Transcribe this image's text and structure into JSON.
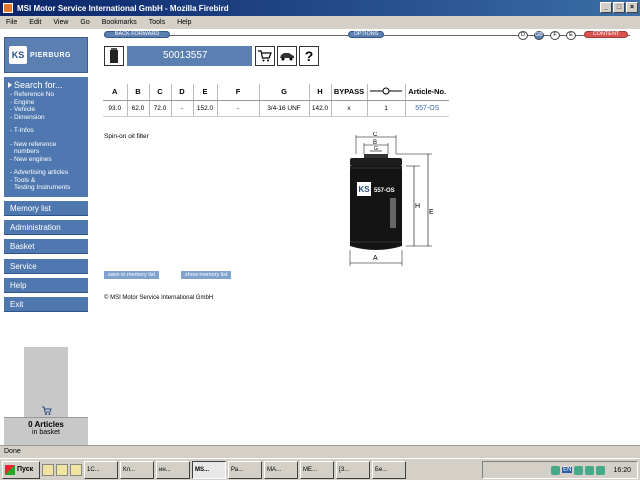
{
  "window": {
    "title": "MSI Motor Service International GmbH - Mozilla Firebird",
    "controls": [
      "_",
      "□",
      "×"
    ]
  },
  "menu": [
    "File",
    "Edit",
    "View",
    "Go",
    "Bookmarks",
    "Tools",
    "Help"
  ],
  "nav": {
    "back_forward": "BACK  FORWARD",
    "options": "OPTIONS",
    "content": "CONTENT",
    "lang_buttons": [
      "D",
      "GB",
      "F",
      "E"
    ]
  },
  "logo": {
    "mark": "KS",
    "text": "PIERBURG"
  },
  "sidebar": {
    "search_title": "Search for...",
    "search_items": [
      "- Reference No",
      "- Engine",
      "- Vehicle",
      "- Dimension"
    ],
    "infos": "- T-Infos",
    "new_items": [
      "- New reference",
      "  numbers",
      "- New engines"
    ],
    "adv_items": [
      "- Advertising articles",
      "- Tools &",
      "  Testing Instruments"
    ],
    "buttons": [
      "Memory list",
      "Administration",
      "Basket",
      "Service",
      "Help",
      "Exit"
    ],
    "basket_count": "0 Articles",
    "basket_label": "in basket"
  },
  "article": {
    "number": "50013557"
  },
  "table": {
    "headers": [
      "A",
      "B",
      "C",
      "D",
      "E",
      "F",
      "G",
      "H",
      "BYPASS",
      "",
      "Article-No."
    ],
    "row": [
      "93.0",
      "62.0",
      "72.0",
      "-",
      "152.0",
      "-",
      "3/4-16 UNF",
      "142.0",
      "x",
      "1",
      "557-OS"
    ]
  },
  "description": "Spin-on oil filter",
  "diagram": {
    "labels": [
      "C",
      "B",
      "G",
      "H",
      "E",
      "A"
    ],
    "product_label": "557-OS"
  },
  "buttons": {
    "save_memory": "save in memory list",
    "show_memory": "show memory list"
  },
  "copyright": "© MSI Motor Service International GmbH",
  "status": "Done",
  "taskbar": {
    "start": "Пуск",
    "tasks": [
      "1C...",
      "Кл...",
      "ин...",
      "MS...",
      "Ра...",
      "МА...",
      "МЕ...",
      "[З...",
      "Бе..."
    ],
    "lang": "EN",
    "clock": "16:20"
  },
  "colors": {
    "nav_blue": "#4f78b0",
    "title_blue": "#0a246a",
    "link_blue": "#3c6fb0",
    "content_red": "#d9534f"
  }
}
